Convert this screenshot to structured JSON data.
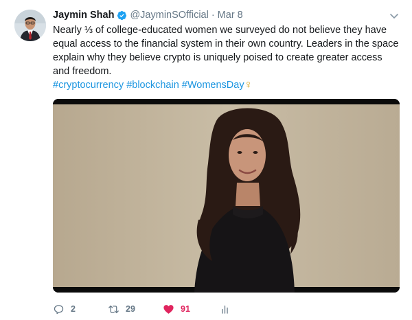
{
  "author": {
    "display_name": "Jaymin Shah",
    "handle": "@JayminSOfficial",
    "separator": "·",
    "date": "Mar 8",
    "verified": true
  },
  "tweet": {
    "text": "Nearly ⅓ of college-educated women we surveyed do not believe they have equal access to the financial system in their own country. Leaders in the space explain why they believe crypto is uniquely poised to create greater access and freedom.",
    "hashtags": [
      "#cryptocurrency",
      "#blockchain",
      "#WomensDay"
    ],
    "emoji": "♀"
  },
  "actions": {
    "replies": "2",
    "retweets": "29",
    "likes": "91"
  },
  "colors": {
    "link": "#1b95e0",
    "like": "#e0245e",
    "verified": "#1da1f2",
    "muted": "#657786"
  }
}
